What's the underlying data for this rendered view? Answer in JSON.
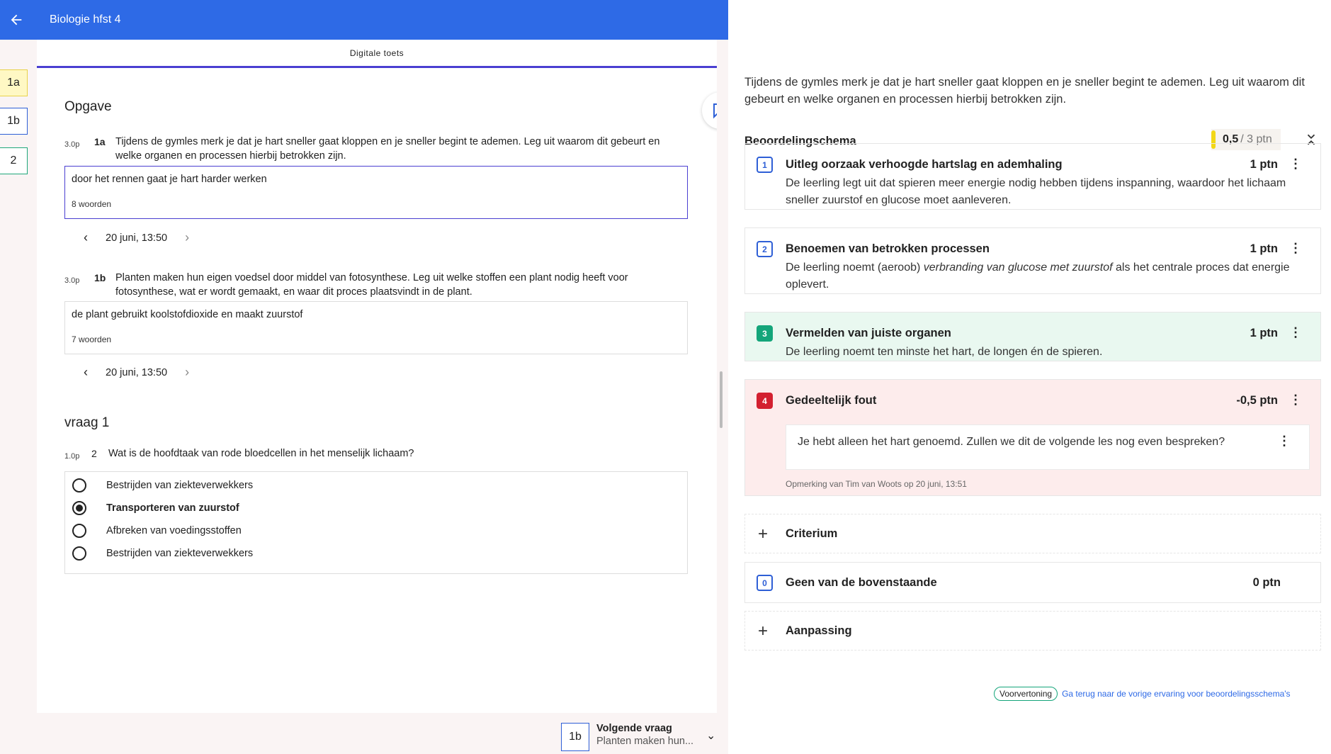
{
  "topbar": {
    "back_icon": "arrow-left-icon",
    "title": "Biologie hfst 4",
    "id": "#4069316"
  },
  "nav": [
    {
      "label": "1a",
      "color": "#f2d716"
    },
    {
      "label": "1b",
      "color": "#2e5fd6"
    },
    {
      "label": "2",
      "color": "#1fa77a"
    }
  ],
  "mid": {
    "tab": "Digitale toets",
    "section1": "Opgave",
    "q1a": {
      "points": "3.0p",
      "num": "1a",
      "text": "Tijdens de gymles merk je dat je hart sneller gaat kloppen en je sneller begint te ademen. Leg uit waarom dit gebeurt en welke organen en processen hierbij betrokken zijn.",
      "answer": "door het rennen gaat je hart harder werken",
      "count": "8 woorden",
      "date": "20 juni, 13:50"
    },
    "q1b": {
      "points": "3.0p",
      "num": "1b",
      "text": "Planten maken hun eigen voedsel door middel van fotosynthese. Leg uit welke stoffen een plant nodig heeft voor fotosynthese, wat er wordt gemaakt, en waar dit proces plaatsvindt in de plant.",
      "answer": "de plant gebruikt koolstofdioxide en maakt zuurstof",
      "count": "7 woorden",
      "date": "20 juni, 13:50"
    },
    "section2": "vraag 1",
    "q2": {
      "points": "1.0p",
      "num": "2",
      "text": "Wat is de hoofdtaak van rode bloedcellen in het menselijk lichaam?",
      "options": [
        "Bestrijden van ziekteverwekkers",
        "Transporteren van zuurstof",
        "Afbreken van voedingsstoffen",
        "Bestrijden van ziekteverwekkers"
      ],
      "selected_index": 1
    },
    "next": {
      "box": "1b",
      "title": "Volgende vraag",
      "subtitle": "Planten maken hun..."
    }
  },
  "right": {
    "question": "Tijdens de gymles merk je dat je hart sneller gaat kloppen en je sneller begint te ademen. Leg uit waarom dit gebeurt en welke organen en processen hierbij betrokken zijn.",
    "heading": "Beoordelingschema",
    "score_got": "0,5",
    "score_total": "/ 3 ptn",
    "criteria": [
      {
        "num": "1",
        "title": "Uitleg oorzaak verhoogde hartslag en ademhaling",
        "points": "1 ptn",
        "desc": "De leerling legt uit dat spieren meer energie nodig hebben tijdens inspanning, waardoor het lichaam sneller zuurstof en glucose moet aanleveren."
      },
      {
        "num": "2",
        "title": "Benoemen van betrokken processen",
        "points": "1 ptn",
        "desc_before": "De leerling noemt (aeroob) ",
        "desc_em": "verbranding van glucose met zuurstof",
        "desc_after": " als het centrale proces dat energie oplevert."
      },
      {
        "num": "3",
        "title": "Vermelden van juiste organen",
        "points": "1 ptn",
        "desc": "De leerling noemt ten minste het hart, de longen én de spieren."
      },
      {
        "num": "4",
        "title": "Gedeeltelijk fout",
        "points": "-0,5 ptn",
        "comment": "Je hebt alleen het hart genoemd. Zullen we dit de volgende les nog even bespreken?",
        "meta": "Opmerking van Tim van Woots op 20 juni, 13:51"
      }
    ],
    "add_criterium": "Criterium",
    "none": {
      "num": "0",
      "title": "Geen van de bovenstaande",
      "points": "0 ptn"
    },
    "add_adjust": "Aanpassing",
    "preview_pill": "Voorvertoning",
    "preview_link": "Ga terug naar de vorige ervaring voor beoordelingsschema's"
  }
}
